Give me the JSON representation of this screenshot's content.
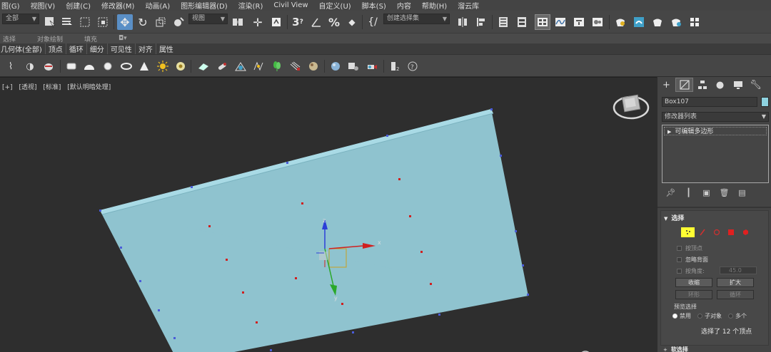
{
  "menu": [
    "图(G)",
    "视图(V)",
    "创建(C)",
    "修改器(M)",
    "动画(A)",
    "图形编辑器(D)",
    "渲染(R)",
    "Civil View",
    "自定义(U)",
    "脚本(S)",
    "内容",
    "帮助(H)",
    "溜云库"
  ],
  "toolbar": {
    "selection_filter": "全部",
    "reference_coord": "视图",
    "named_selection_placeholder": "创建选择集"
  },
  "ribbon": {
    "row1": [
      "选择",
      "对象绘制",
      "填充"
    ],
    "row2": [
      "几何体(全部)",
      "顶点",
      "循环",
      "细分",
      "可见性",
      "对齐",
      "属性"
    ]
  },
  "viewport": {
    "labels": [
      "[+]",
      "[透视]",
      "[标准]",
      "[默认明暗处理]"
    ],
    "axes": {
      "x": "x",
      "y": "y",
      "z": "z"
    },
    "plane_color": "#8fc3cf",
    "plane_edge_color": "#9fd4e0"
  },
  "command_panel": {
    "object_name": "Box107",
    "object_color": "#8ed3e0",
    "modifier_list": "修改器列表",
    "stack_item": "可编辑多边形",
    "selection_rollout": {
      "title": "选择",
      "by_vertex": "按顶点",
      "ignore_backfacing": "忽略背面",
      "angle_label": "按角度:",
      "angle_value": "45.0",
      "shrink": "收缩",
      "grow": "扩大",
      "ring": "环形",
      "loop": "循环",
      "preview_title": "预览选择",
      "preview_options": [
        "禁用",
        "子对象",
        "多个"
      ],
      "status": "选择了 12 个顶点"
    },
    "soft_selection": "软选择"
  }
}
